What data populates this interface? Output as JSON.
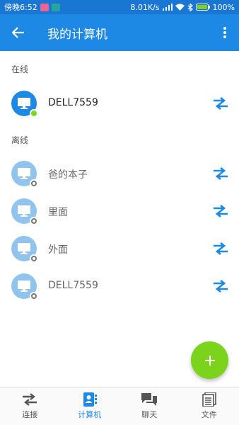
{
  "status_bar": {
    "time": "傍晚6:52",
    "network_speed": "8.01K/s",
    "battery": "100%"
  },
  "app_bar": {
    "title": "我的计算机"
  },
  "sections": {
    "online_header": "在线",
    "offline_header": "离线"
  },
  "online_computers": [
    {
      "name": "DELL7559"
    }
  ],
  "offline_computers": [
    {
      "name": "爸的本子"
    },
    {
      "name": "里面"
    },
    {
      "name": "外面"
    },
    {
      "name": "DELL7559"
    }
  ],
  "bottom_nav": {
    "items": [
      {
        "label": "连接",
        "icon": "swap-arrows-icon"
      },
      {
        "label": "计算机",
        "icon": "contacts-book-icon"
      },
      {
        "label": "聊天",
        "icon": "chat-bubbles-icon"
      },
      {
        "label": "文件",
        "icon": "files-icon"
      }
    ],
    "active_index": 1
  },
  "colors": {
    "primary": "#1e88e5",
    "status_bar": "#1976d2",
    "accent": "#7cd31b",
    "offline_avatar": "#90c4ee"
  }
}
